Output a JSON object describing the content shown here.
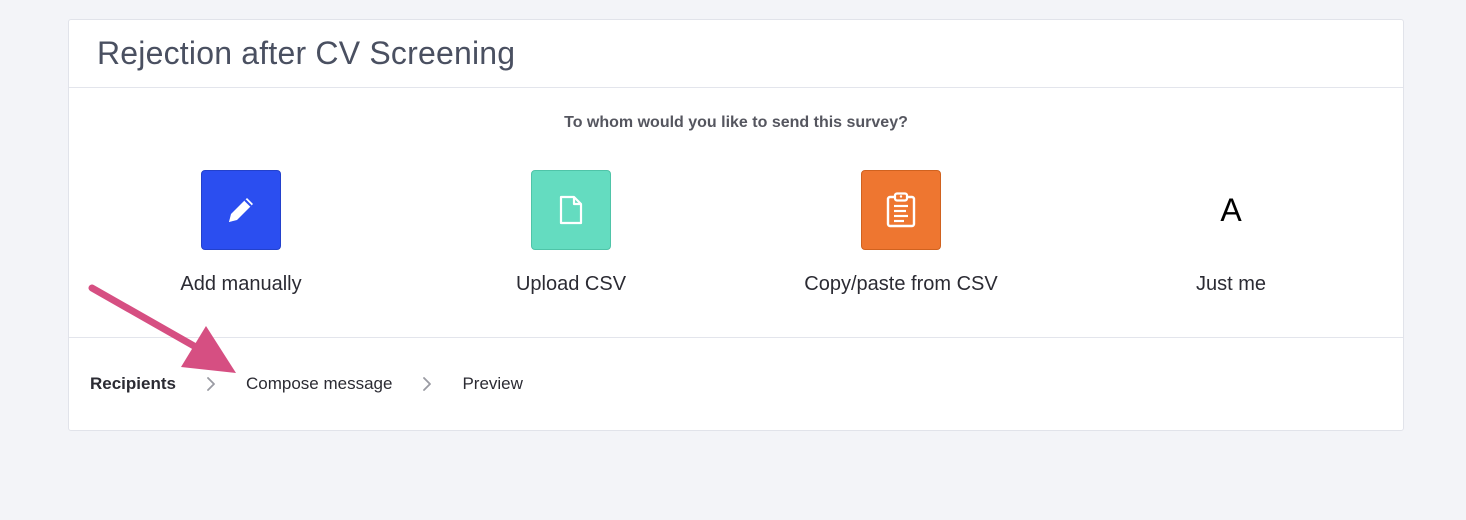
{
  "header": {
    "title": "Rejection after CV Screening"
  },
  "body": {
    "question": "To whom would you like to send this survey?",
    "options": [
      {
        "label": "Add manually",
        "icon": "pencil-icon",
        "color": "#2b4ef0"
      },
      {
        "label": "Upload CSV",
        "icon": "file-icon",
        "color": "#64dcc0"
      },
      {
        "label": "Copy/paste from CSV",
        "icon": "clipboard-icon",
        "color": "#ee7630"
      },
      {
        "label": "Just me",
        "icon": "avatar",
        "avatar_letter": "A"
      }
    ]
  },
  "steps": [
    {
      "label": "Recipients",
      "active": true
    },
    {
      "label": "Compose message",
      "active": false
    },
    {
      "label": "Preview",
      "active": false
    }
  ],
  "annotation": {
    "arrow_color": "#d64f82"
  }
}
